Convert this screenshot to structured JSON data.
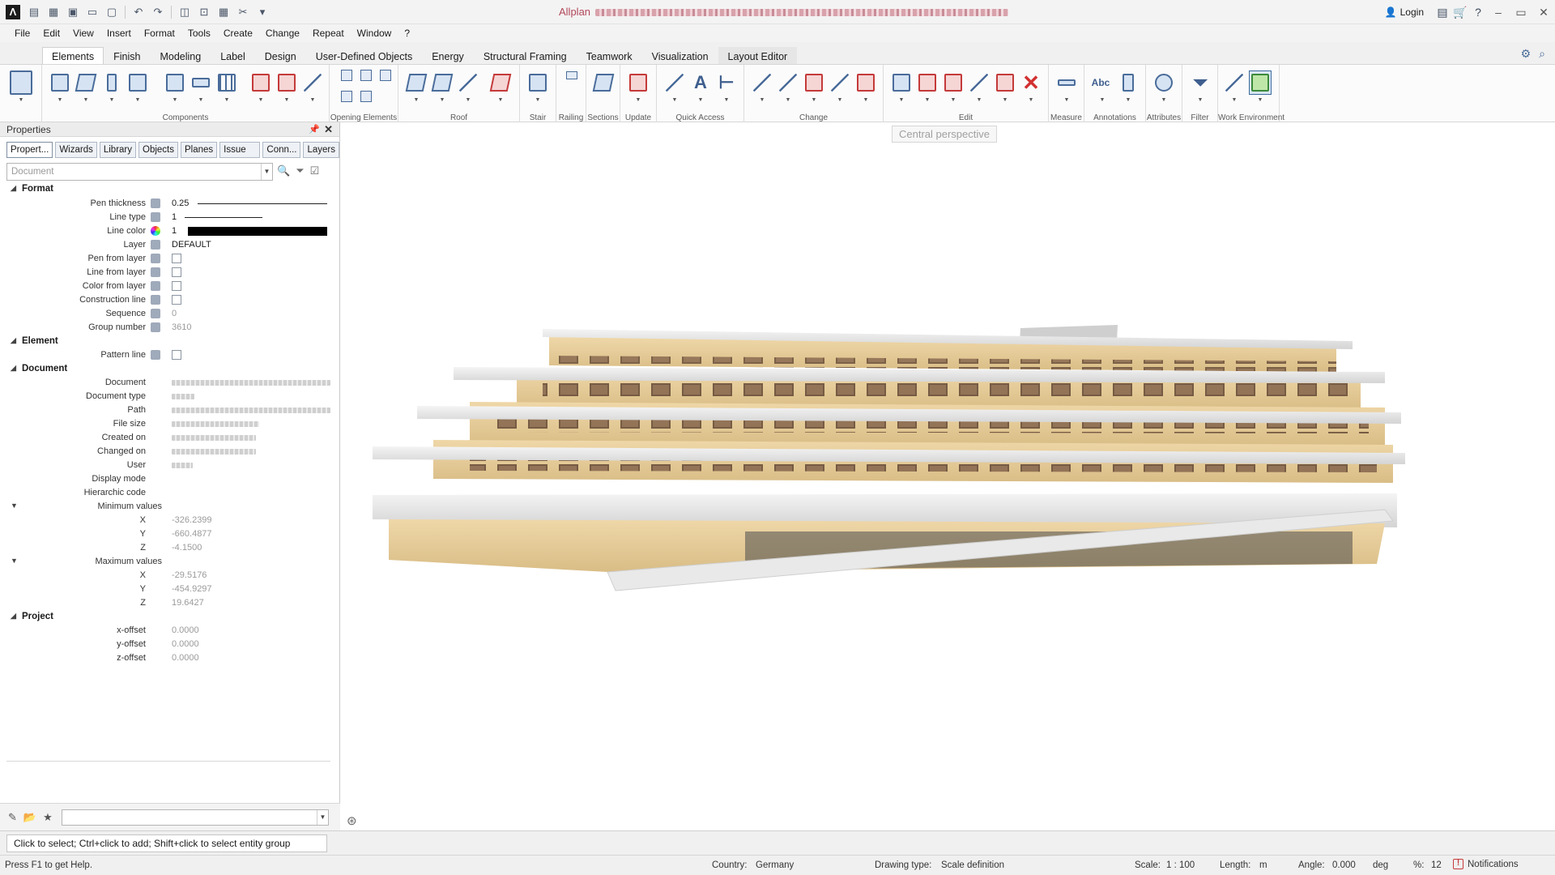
{
  "titlebar": {
    "app_name": "Allplan",
    "user_label": "Login"
  },
  "menu": [
    "File",
    "Edit",
    "View",
    "Insert",
    "Format",
    "Tools",
    "Create",
    "Change",
    "Repeat",
    "Window",
    "?"
  ],
  "ribbon_tabs": [
    "Elements",
    "Finish",
    "Modeling",
    "Label",
    "Design",
    "User-Defined Objects",
    "Energy",
    "Structural Framing",
    "Teamwork",
    "Visualization",
    "Layout Editor"
  ],
  "ribbon_groups": [
    "Components",
    "Opening Elements",
    "Roof",
    "Stair",
    "Railing",
    "Sections",
    "Update",
    "Quick Access",
    "Change",
    "Edit",
    "Measure",
    "Annotations",
    "Attributes",
    "Filter",
    "Work Environment"
  ],
  "ribbon_text_icons": {
    "annotation_abc": "Abc",
    "quick_text": "A"
  },
  "properties": {
    "title": "Properties",
    "tabs": [
      "Propert...",
      "Wizards",
      "Library",
      "Objects",
      "Planes",
      "Issue ...",
      "Conn...",
      "Layers"
    ],
    "selector_placeholder": "Document",
    "sections": {
      "format": "Format",
      "element": "Element",
      "document": "Document",
      "project": "Project"
    },
    "format": {
      "pen_thickness_label": "Pen thickness",
      "pen_thickness_value": "0.25",
      "line_type_label": "Line type",
      "line_type_value": "1",
      "line_color_label": "Line color",
      "line_color_value": "1",
      "layer_label": "Layer",
      "layer_value": "DEFAULT",
      "pen_from_layer_label": "Pen from layer",
      "line_from_layer_label": "Line from layer",
      "color_from_layer_label": "Color from layer",
      "construction_line_label": "Construction line",
      "sequence_label": "Sequence",
      "sequence_value": "0",
      "group_number_label": "Group number",
      "group_number_value": "3610"
    },
    "element": {
      "pattern_line_label": "Pattern line"
    },
    "document": {
      "document_label": "Document",
      "document_type_label": "Document type",
      "path_label": "Path",
      "file_size_label": "File size",
      "created_on_label": "Created on",
      "changed_on_label": "Changed on",
      "user_label": "User",
      "display_mode_label": "Display mode",
      "hierarchic_code_label": "Hierarchic code",
      "min_values_label": "Minimum values",
      "min_x": "-326.2399",
      "min_y": "-660.4877",
      "min_z": "-4.1500",
      "max_values_label": "Maximum values",
      "max_x": "-29.5176",
      "max_y": "-454.9297",
      "max_z": "19.6427",
      "x_label": "X",
      "y_label": "Y",
      "z_label": "Z"
    },
    "project": {
      "x_offset_label": "x-offset",
      "x_offset_value": "0.0000",
      "y_offset_label": "y-offset",
      "y_offset_value": "0.0000",
      "z_offset_label": "z-offset",
      "z_offset_value": "0.0000"
    }
  },
  "viewport": {
    "view_label": "Central perspective"
  },
  "hint": "Click to select; Ctrl+click to add; Shift+click to select entity group",
  "status": {
    "help": "Press F1 to get Help.",
    "country_label": "Country:",
    "country_value": "Germany",
    "drawing_type_label": "Drawing type:",
    "drawing_type_value": "Scale definition",
    "scale_label": "Scale:",
    "scale_value": "1 : 100",
    "length_label": "Length:",
    "length_value": "m",
    "angle_label": "Angle:",
    "angle_value": "0.000",
    "angle_unit": "deg",
    "percent_label": "%:",
    "percent_value": "12",
    "notifications": "Notifications"
  },
  "colors": {
    "accent": "#4a6c9a",
    "title_text": "#b2475a",
    "building_facade": "#e8cf9f",
    "building_slab": "#e6e6e6"
  }
}
